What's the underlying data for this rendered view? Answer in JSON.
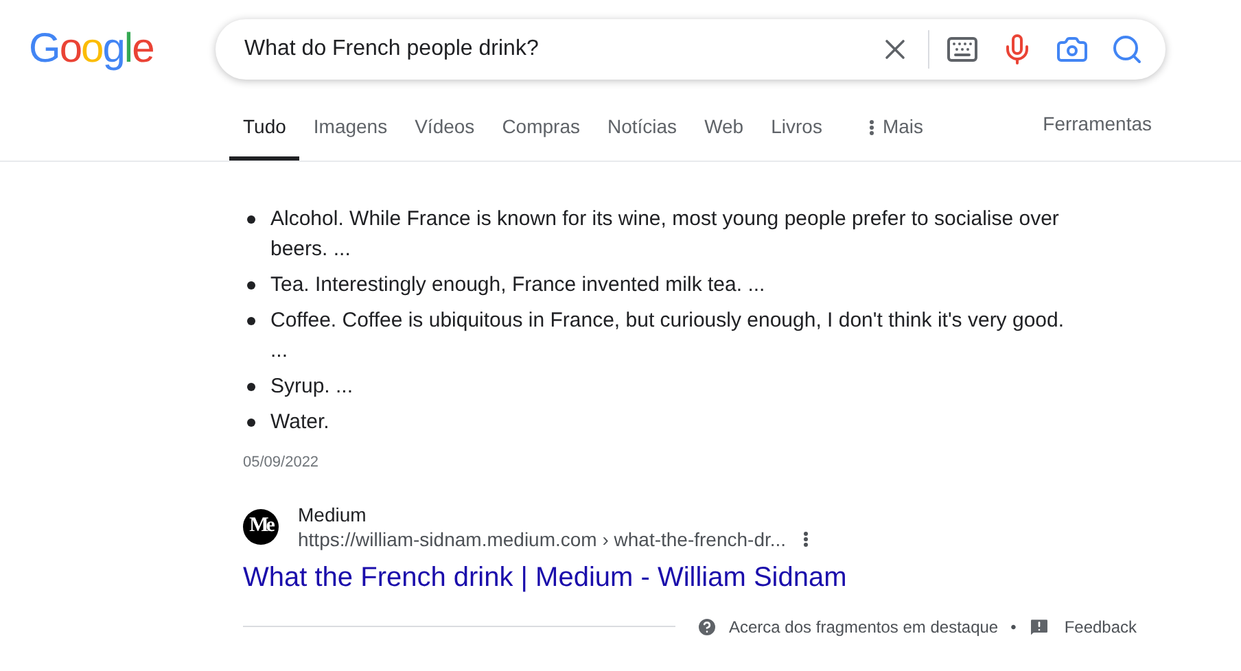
{
  "logo": "Google",
  "search": {
    "value": "What do French people drink?"
  },
  "tabs": [
    {
      "label": "Tudo",
      "selected": true
    },
    {
      "label": "Imagens",
      "selected": false
    },
    {
      "label": "Vídeos",
      "selected": false
    },
    {
      "label": "Compras",
      "selected": false
    },
    {
      "label": "Notícias",
      "selected": false
    },
    {
      "label": "Web",
      "selected": false
    },
    {
      "label": "Livros",
      "selected": false
    },
    {
      "label": "Mais",
      "selected": false,
      "kind": "more"
    }
  ],
  "tools": "Ferramentas",
  "snippet": {
    "items": [
      "Alcohol. While France is known for its wine, most young people prefer to socialise over beers. ...",
      "Tea. Interestingly enough, France invented milk tea. ...",
      "Coffee. Coffee is ubiquitous in France, but curiously enough, I don't think it's very good. ...",
      "Syrup. ...",
      "Water."
    ],
    "date": "05/09/2022"
  },
  "result": {
    "favicon": "Me",
    "site": "Medium",
    "url": "https://william-sidnam.medium.com › what-the-french-dr...",
    "title": "What the French drink | Medium - William Sidnam"
  },
  "footer": {
    "about": "Acerca dos fragmentos em destaque",
    "separator": "•",
    "feedback": "Feedback"
  }
}
